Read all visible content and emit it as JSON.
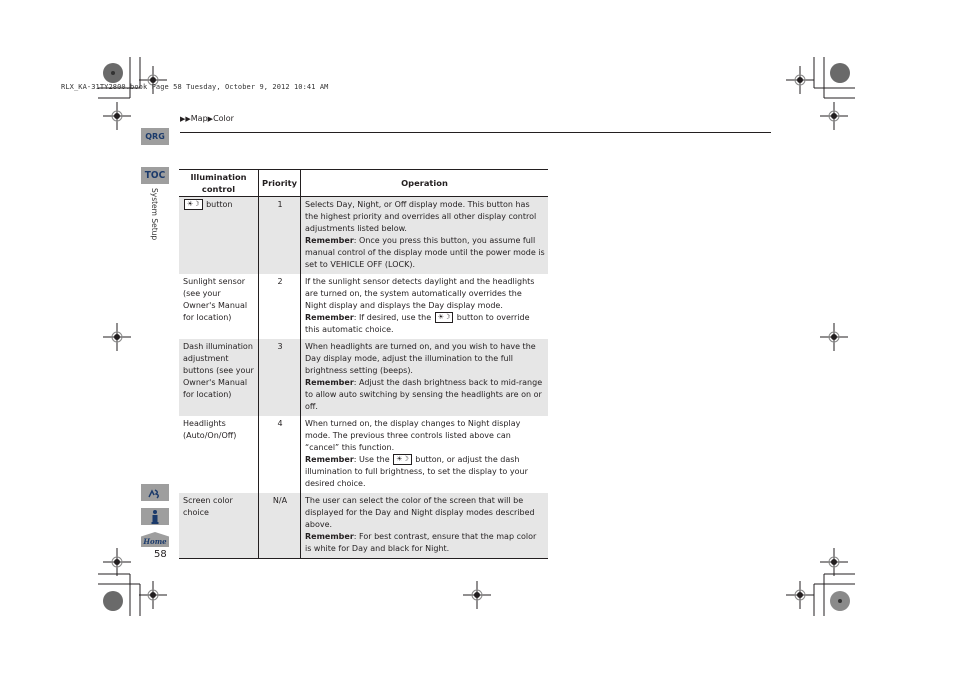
{
  "print_header": "RLX_KA-31TY2800.book  Page 58  Tuesday, October 9, 2012  10:41 AM",
  "breadcrumb": {
    "separator_icon": "triangle-right-icon",
    "items": [
      "Map",
      "Color"
    ]
  },
  "side_nav": {
    "qrg_label": "QRG",
    "toc_label": "TOC",
    "section_label": "System Setup",
    "voice_icon": "voice-command-icon",
    "info_icon": "info-icon",
    "home_label": "Home"
  },
  "page_number": "58",
  "table": {
    "headers": [
      "Illumination control",
      "Priority",
      "Operation"
    ],
    "remember_label": "Remember",
    "button_icon": "day-night-button-icon",
    "rows": [
      {
        "control_suffix": " button",
        "priority": "1",
        "operation": "Selects Day, Night, or Off display mode. This button has the highest priority and overrides all other display control adjustments listed below.",
        "remember": ": Once you press this button, you assume full manual control of the display mode until the power mode is set to VEHICLE OFF (LOCK)."
      },
      {
        "control": "Sunlight sensor (see your Owner's Manual for location)",
        "priority": "2",
        "operation": "If the sunlight sensor detects daylight and the headlights are turned on, the system automatically overrides the Night display and displays the Day display mode.",
        "remember_pre": ": If desired, use the ",
        "remember_post": " button to override this automatic choice."
      },
      {
        "control": "Dash illumination adjustment buttons (see your Owner's Manual for location)",
        "priority": "3",
        "operation": "When headlights are turned on, and you wish to have the Day display mode, adjust the illumination to the full brightness setting (beeps).",
        "remember": ": Adjust the dash brightness back to mid-range to allow auto switching by sensing the headlights are on or off."
      },
      {
        "control": "Headlights (Auto/On/Off)",
        "priority": "4",
        "operation": "When turned on, the display changes to Night display mode. The previous three controls listed above can “cancel” this function.",
        "remember_pre": ": Use the ",
        "remember_post": " button, or adjust the dash illumination to full brightness, to set the display to your desired choice."
      },
      {
        "control": "Screen color choice",
        "priority": "N/A",
        "operation": "The user can select the color of the screen that will be displayed for the Day and Night display modes described above.",
        "remember": ": For best contrast, ensure that the map color is white for Day and black for Night."
      }
    ]
  },
  "icon_glyphs": {
    "day_night": "☀☽"
  }
}
